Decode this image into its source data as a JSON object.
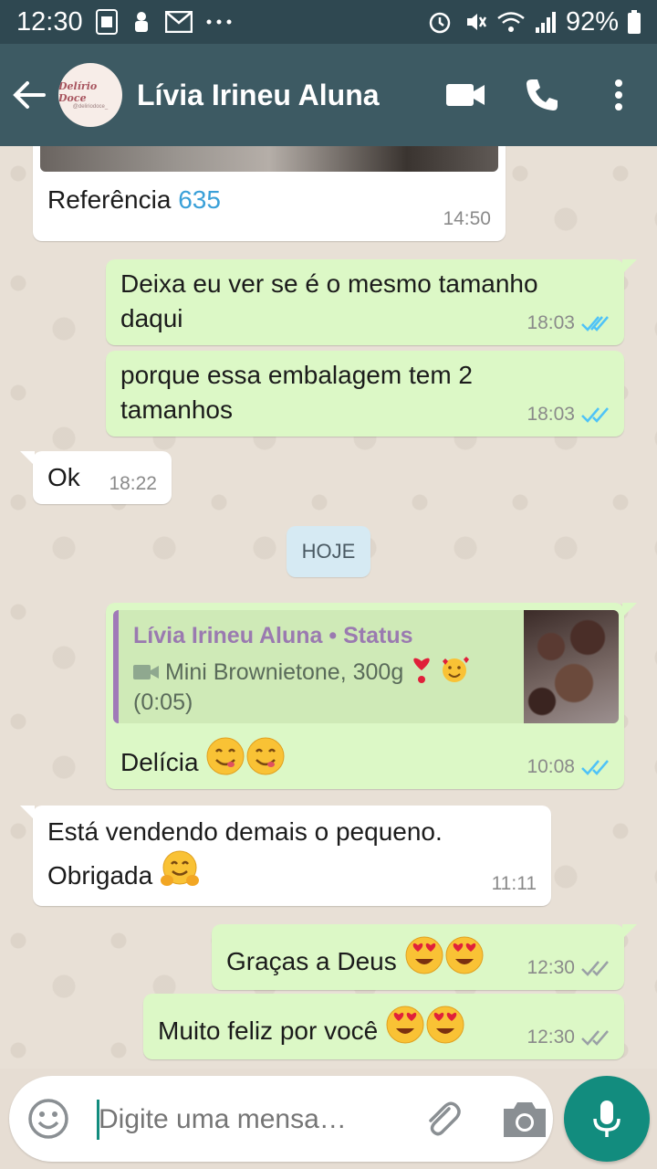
{
  "status_bar": {
    "time": "12:30",
    "notification_icons": [
      "sim-card-icon",
      "android-debug-icon",
      "gmail-icon",
      "more-dots-icon"
    ],
    "right_icons": [
      "alarm-icon",
      "vibrate-mute-icon",
      "wifi-icon",
      "signal-icon"
    ],
    "battery": "92%"
  },
  "header": {
    "contact_name": "Lívia Irineu Aluna",
    "avatar_logo": "Delírio Doce",
    "avatar_sub": "@deliriodoce_",
    "actions": [
      "video-call-icon",
      "phone-icon",
      "more-vert-icon"
    ]
  },
  "messages": [
    {
      "dir": "in",
      "text_prefix": "Referência ",
      "link": "635",
      "time": "14:50"
    },
    {
      "dir": "out",
      "text": "Deixa eu ver se é o mesmo tamanho daqui",
      "time": "18:03",
      "status": "read"
    },
    {
      "dir": "out",
      "text": "porque essa embalagem tem 2 tamanhos",
      "time": "18:03",
      "status": "read"
    },
    {
      "dir": "in",
      "text": "Ok",
      "time": "18:22"
    },
    {
      "dir": "out",
      "quote": {
        "author": "Lívia Irineu Aluna • Status",
        "text": "Mini Brownietone, 300g",
        "duration": "(0:05)"
      },
      "text": "Delícia",
      "time": "10:08",
      "status": "read"
    },
    {
      "dir": "in",
      "text": "Está vendendo demais o pequeno. Obrigada",
      "time": "11:11"
    },
    {
      "dir": "out",
      "text": "Graças a Deus",
      "time": "12:30",
      "status": "delivered"
    },
    {
      "dir": "out",
      "text": "Muito feliz por você",
      "time": "12:30",
      "status": "delivered"
    }
  ],
  "date_divider": "HOJE",
  "composer": {
    "placeholder": "Digite uma mensa…"
  },
  "colors": {
    "header": "#3d5a63",
    "status_bar": "#2f4851",
    "outgoing": "#dcf8c6",
    "incoming": "#ffffff",
    "link": "#3aa0d8",
    "read_ticks": "#4fc3f7",
    "fab": "#128c7e"
  }
}
